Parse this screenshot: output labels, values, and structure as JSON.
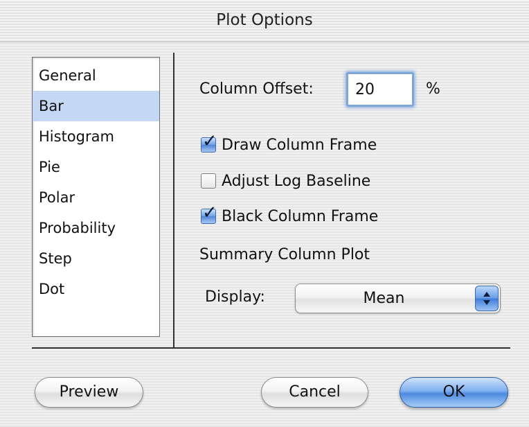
{
  "window": {
    "title": "Plot Options"
  },
  "categories": {
    "items": [
      {
        "label": "General"
      },
      {
        "label": "Bar"
      },
      {
        "label": "Histogram"
      },
      {
        "label": "Pie"
      },
      {
        "label": "Polar"
      },
      {
        "label": "Probability"
      },
      {
        "label": "Step"
      },
      {
        "label": "Dot"
      }
    ],
    "selected": "Bar"
  },
  "bar_options": {
    "column_offset_label": "Column Offset:",
    "column_offset_value": "20",
    "column_offset_unit": "%",
    "draw_column_frame": {
      "label": "Draw Column Frame",
      "checked": true
    },
    "adjust_log_baseline": {
      "label": "Adjust Log Baseline",
      "checked": false
    },
    "black_column_frame": {
      "label": "Black Column Frame",
      "checked": true
    },
    "summary_heading": "Summary Column Plot",
    "display_label": "Display:",
    "display_value": "Mean"
  },
  "buttons": {
    "preview": "Preview",
    "cancel": "Cancel",
    "ok": "OK"
  },
  "colors": {
    "selection": "#c4d8f3",
    "accent_blue": "#4d8ae0",
    "focus_ring": "#7fa6d8"
  }
}
